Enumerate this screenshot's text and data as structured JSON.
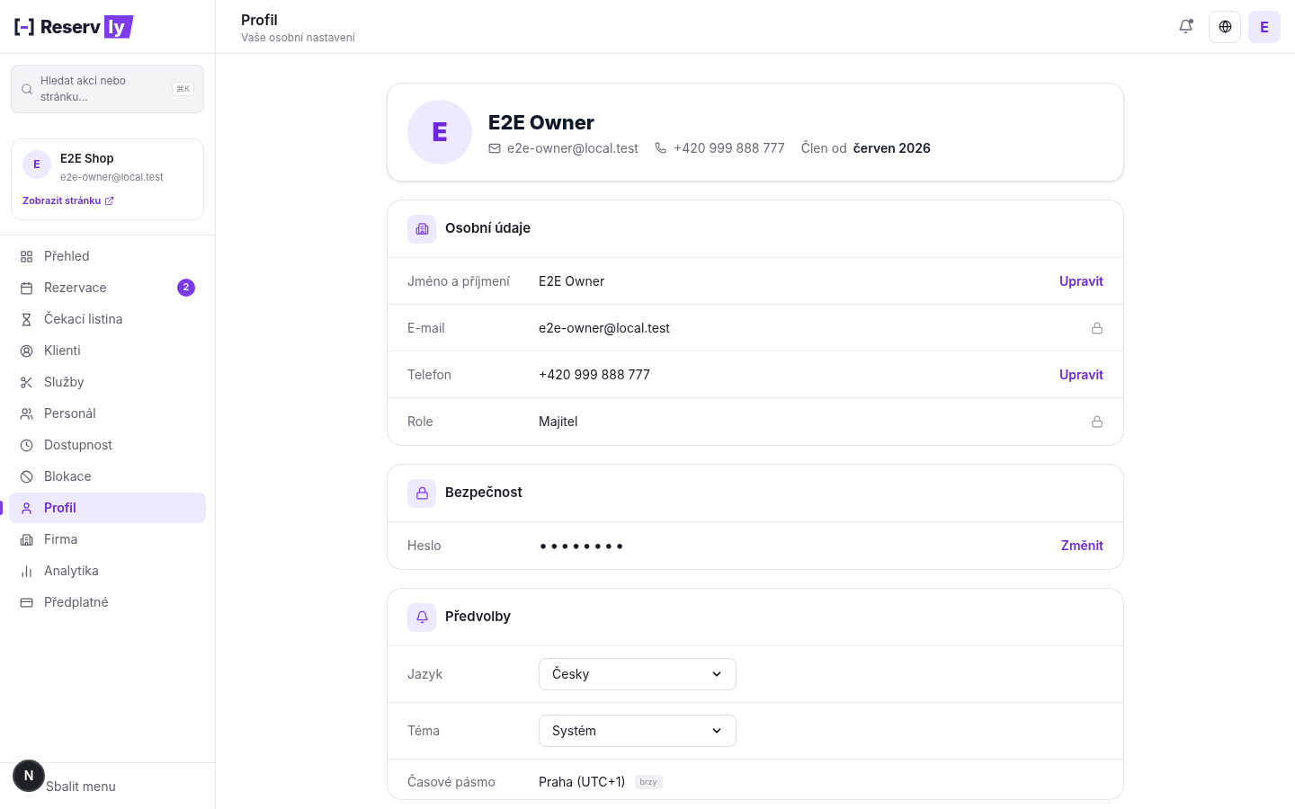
{
  "logo": {
    "text": "Reserv",
    "accent": "ly"
  },
  "search": {
    "placeholder": "Hledat akci nebo stránku...",
    "shortcut": "⌘K"
  },
  "shop": {
    "avatar": "E",
    "name": "E2E Shop",
    "email": "e2e-owner@local.test",
    "link": "Zobrazit stránku"
  },
  "nav": [
    {
      "label": "Přehled",
      "selected": false
    },
    {
      "label": "Rezervace",
      "selected": false,
      "badge": "2"
    },
    {
      "label": "Čekací listina",
      "selected": false
    },
    {
      "label": "Klienti",
      "selected": false
    },
    {
      "label": "Služby",
      "selected": false
    },
    {
      "label": "Personál",
      "selected": false
    },
    {
      "label": "Dostupnost",
      "selected": false
    },
    {
      "label": "Blokace",
      "selected": false
    },
    {
      "label": "Profil",
      "selected": true
    },
    {
      "label": "Firma",
      "selected": false
    },
    {
      "label": "Analytika",
      "selected": false
    },
    {
      "label": "Předplatné",
      "selected": false
    }
  ],
  "collapse": {
    "label": "Sbalit menu"
  },
  "dev_badge": {
    "text": "N"
  },
  "header": {
    "title": "Profil",
    "subtitle": "Vaše osobní nastavení",
    "avatar": "E"
  },
  "profile": {
    "avatar": "E",
    "name": "E2E Owner",
    "email": "e2e-owner@local.test",
    "phone": "+420 999 888 777",
    "member_label": "Člen od",
    "member_since": "červen 2026"
  },
  "sections": [
    {
      "title": "Osobní údaje",
      "rows": [
        {
          "kind": "editable",
          "label": "Jméno a příjmení",
          "value": "E2E Owner",
          "action": "Upravit"
        },
        {
          "kind": "locked",
          "label": "E-mail",
          "value": "e2e-owner@local.test"
        },
        {
          "kind": "editable",
          "label": "Telefon",
          "value": "+420 999 888 777",
          "action": "Upravit"
        },
        {
          "kind": "locked",
          "label": "Role",
          "value": "Majitel"
        }
      ]
    },
    {
      "title": "Bezpečnost",
      "rows": [
        {
          "kind": "password",
          "label": "Heslo",
          "value": "••••••••",
          "action": "Změnit"
        }
      ]
    },
    {
      "title": "Předvolby",
      "rows": [
        {
          "kind": "select",
          "label": "Jazyk",
          "value": "Česky"
        },
        {
          "kind": "select",
          "label": "Téma",
          "value": "Systém"
        },
        {
          "kind": "text",
          "label": "Časové pásmo",
          "value": "Praha (UTC+1)",
          "badge": "brzy"
        }
      ]
    }
  ]
}
